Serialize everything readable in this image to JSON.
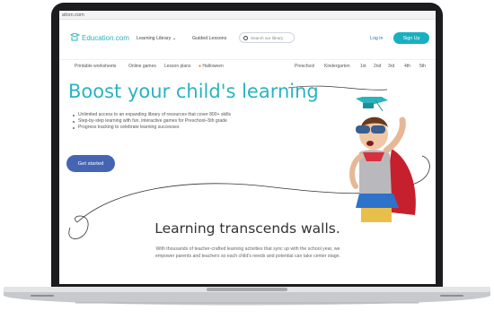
{
  "browser": {
    "url": "ation.com"
  },
  "nav": {
    "logo_text": "Education.com",
    "learning_library": "Learning Library",
    "guided_lessons": "Guided Lessons",
    "search_placeholder": "Search our library",
    "login": "Log in",
    "signup": "Sign Up"
  },
  "subnav": {
    "left": [
      "Printable worksheets",
      "Online games",
      "Lesson plans",
      "Halloween"
    ],
    "grades": [
      "Preschool",
      "Kindergarten",
      "1st",
      "2nd",
      "3rd",
      "4th",
      "5th"
    ]
  },
  "hero": {
    "title": "Boost your child's learning",
    "bullets": [
      "Unlimited access to an expanding library of resources that cover 800+ skills",
      "Step-by-step learning with fun, interactive games for Preschool–5th grade",
      "Progress tracking to celebrate learning successes"
    ],
    "cta": "Get started"
  },
  "section": {
    "title": "Learning transcends walls.",
    "text_line1": "With thousands of teacher-crafted learning activities that sync up with the school year, we",
    "text_line2": "empower parents and teachers so each child's needs and potential can take center stage."
  },
  "colors": {
    "brand": "#2bb3c0",
    "cta": "#4564b3",
    "signup": "#18b0c0"
  }
}
